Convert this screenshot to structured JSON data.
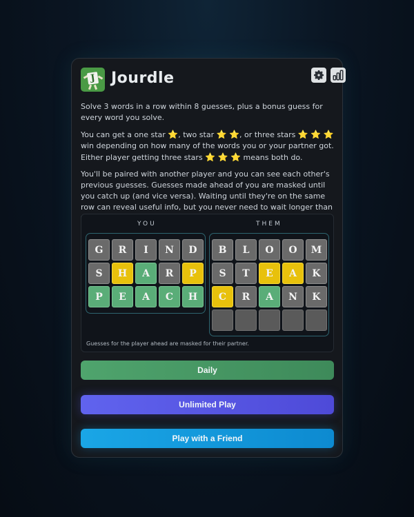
{
  "app": {
    "title": "Jourdle",
    "logo_letter": "J"
  },
  "intro": {
    "p1": "Solve 3 words in a row within 8 guesses, plus a bonus guess for every word you solve.",
    "p2_a": "You can get a one star",
    "p2_b": ", two star",
    "p2_c": ", or three stars",
    "p2_d": "win depending on how many of the words you or your partner got. Either player getting three stars",
    "p2_e": "means both do.",
    "p3": "You'll be paired with another player and you can see each other's previous guesses. Guesses made ahead of you are masked until you catch up (and vice versa). Waiting until they're on the same row can reveal useful info, but you never need to wait longer than that.",
    "star": "⭐"
  },
  "board": {
    "you_label": "YOU",
    "them_label": "THEM",
    "note": "Guesses for the player ahead are masked for their partner.",
    "you_rows": [
      [
        {
          "l": "G",
          "s": "gray"
        },
        {
          "l": "R",
          "s": "gray"
        },
        {
          "l": "I",
          "s": "gray"
        },
        {
          "l": "N",
          "s": "gray"
        },
        {
          "l": "D",
          "s": "gray"
        }
      ],
      [
        {
          "l": "S",
          "s": "gray"
        },
        {
          "l": "H",
          "s": "yellow"
        },
        {
          "l": "A",
          "s": "green"
        },
        {
          "l": "R",
          "s": "gray"
        },
        {
          "l": "P",
          "s": "yellow"
        }
      ],
      [
        {
          "l": "P",
          "s": "green"
        },
        {
          "l": "E",
          "s": "green"
        },
        {
          "l": "A",
          "s": "green"
        },
        {
          "l": "C",
          "s": "green"
        },
        {
          "l": "H",
          "s": "green"
        }
      ]
    ],
    "them_rows": [
      [
        {
          "l": "B",
          "s": "gray"
        },
        {
          "l": "L",
          "s": "gray"
        },
        {
          "l": "O",
          "s": "gray"
        },
        {
          "l": "O",
          "s": "gray"
        },
        {
          "l": "M",
          "s": "gray"
        }
      ],
      [
        {
          "l": "S",
          "s": "gray"
        },
        {
          "l": "T",
          "s": "gray"
        },
        {
          "l": "E",
          "s": "yellow"
        },
        {
          "l": "A",
          "s": "yellow"
        },
        {
          "l": "K",
          "s": "gray"
        }
      ],
      [
        {
          "l": "C",
          "s": "yellow"
        },
        {
          "l": "R",
          "s": "gray"
        },
        {
          "l": "A",
          "s": "green"
        },
        {
          "l": "N",
          "s": "gray"
        },
        {
          "l": "K",
          "s": "gray"
        }
      ],
      [
        {
          "l": "",
          "s": "empty"
        },
        {
          "l": "",
          "s": "empty"
        },
        {
          "l": "",
          "s": "empty"
        },
        {
          "l": "",
          "s": "empty"
        },
        {
          "l": "",
          "s": "empty"
        }
      ]
    ]
  },
  "buttons": {
    "daily": "Daily",
    "unlimited": "Unlimited Play",
    "friend": "Play with a Friend"
  },
  "icons": {
    "settings": "gear-icon",
    "stats": "bar-chart-icon"
  },
  "colors": {
    "green": "#5aad78",
    "yellow": "#e8c10c",
    "gray": "#6a6a6a"
  }
}
